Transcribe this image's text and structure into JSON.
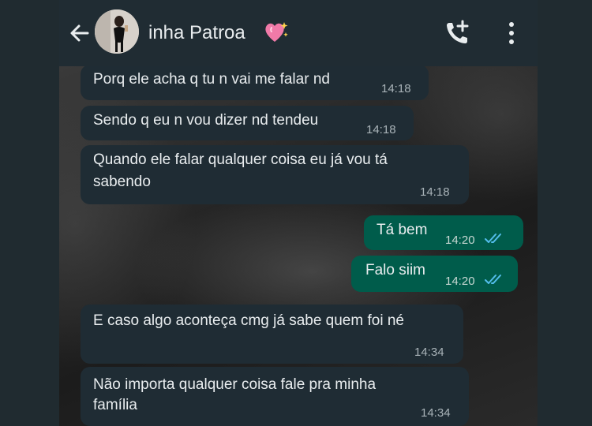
{
  "header": {
    "contact_name": "inha Patroa",
    "icons": {
      "back": "arrow-left-icon",
      "heart": "sparkling-heart-icon",
      "call": "add-call-icon",
      "menu": "more-vertical-icon"
    }
  },
  "messages": [
    {
      "direction": "in",
      "text": "Porq ele acha q tu n vai me falar nd",
      "time": "14:18"
    },
    {
      "direction": "in",
      "text": "Sendo q eu n vou dizer nd tendeu",
      "time": "14:18"
    },
    {
      "direction": "in",
      "text_line1": "Quando ele falar qualquer coisa eu já vou tá",
      "text_line2": "sabendo",
      "time": "14:18"
    },
    {
      "direction": "out",
      "text": "Tá bem",
      "time": "14:20",
      "status": "read"
    },
    {
      "direction": "out",
      "text": "Falo siim",
      "time": "14:20",
      "status": "read"
    },
    {
      "direction": "in",
      "text": "E caso algo aconteça cmg já sabe quem foi né",
      "time": "14:34"
    },
    {
      "direction": "in",
      "text_line1": "Não importa qualquer coisa fale pra minha",
      "text_line2": "família",
      "time": "14:34"
    }
  ],
  "colors": {
    "header_bg": "#202c33",
    "incoming_bubble": "#1f2c34",
    "outgoing_bubble": "#005c4b",
    "read_ticks": "#53bdeb"
  }
}
